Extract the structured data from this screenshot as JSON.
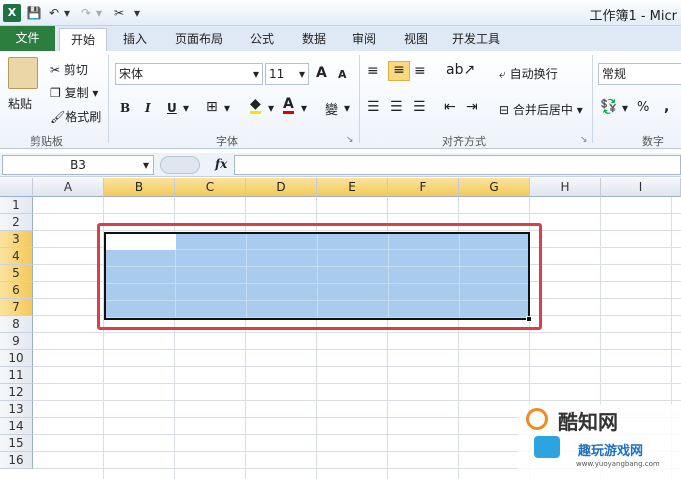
{
  "window": {
    "title": "工作簿1 - Micr"
  },
  "quick_access": {
    "logo": "X",
    "save": "💾",
    "undo": "↶",
    "undo_drop": "▾",
    "redo": "↷",
    "redo_drop": "▾",
    "tools": "✂",
    "more": "▾"
  },
  "tabs": [
    "文件",
    "开始",
    "插入",
    "页面布局",
    "公式",
    "数据",
    "审阅",
    "视图",
    "开发工具"
  ],
  "clipboard": {
    "paste": "粘贴",
    "cut": "剪切",
    "copy": "复制",
    "format_painter": "格式刷",
    "group": "剪贴板"
  },
  "font": {
    "name": "宋体",
    "size": "11",
    "group": "字体",
    "grow": "A",
    "shrink": "A",
    "bold": "B",
    "italic": "I",
    "underline": "U"
  },
  "alignment": {
    "wrap": "自动换行",
    "merge": "合并后居中",
    "group": "对齐方式"
  },
  "number": {
    "format": "常规",
    "percent": "%",
    "comma": ",",
    "group": "数字"
  },
  "formula_bar": {
    "name_box": "B3",
    "fx": "fx",
    "value": ""
  },
  "columns": [
    "A",
    "B",
    "C",
    "D",
    "E",
    "F",
    "G",
    "H",
    "I"
  ],
  "selected_columns": [
    "B",
    "C",
    "D",
    "E",
    "F",
    "G"
  ],
  "rows": [
    "1",
    "2",
    "3",
    "4",
    "5",
    "6",
    "7",
    "8",
    "9",
    "10",
    "11",
    "12",
    "13",
    "14",
    "15",
    "16"
  ],
  "selected_rows": [
    "3",
    "4",
    "5",
    "6",
    "7"
  ],
  "selection": {
    "range": "B3:G7",
    "active": "B3"
  },
  "watermark": {
    "brand": "酷知网",
    "sub": "趣玩游戏网",
    "url": "www.yuoyangbang.com"
  }
}
